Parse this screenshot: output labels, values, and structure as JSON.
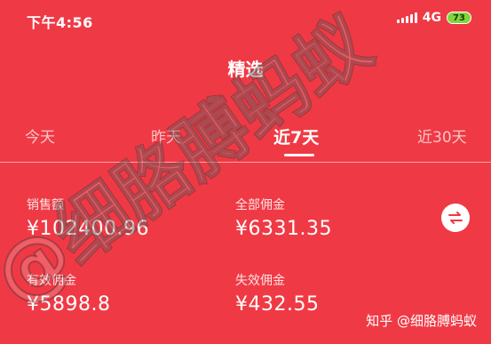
{
  "status_bar": {
    "time": "下午4:56",
    "network": "4G",
    "battery": "73",
    "colors": {
      "battery_fill": "#7ed63c"
    }
  },
  "header": {
    "title": "精选"
  },
  "tabs": [
    {
      "label": "今天",
      "active": false
    },
    {
      "label": "昨天",
      "active": false
    },
    {
      "label": "近7天",
      "active": true
    },
    {
      "label": "近30天",
      "active": false
    }
  ],
  "stats": {
    "sales": {
      "label": "销售额",
      "value": "¥102400.96"
    },
    "total_commission": {
      "label": "全部佣金",
      "value": "¥6331.35"
    },
    "valid_commission": {
      "label": "有效佣金",
      "value": "¥5898.8"
    },
    "invalid_commission": {
      "label": "失效佣金",
      "value": "¥432.55"
    }
  },
  "swap_icon": "swap-arrows-icon",
  "watermark": {
    "credit": "知乎 @细胳膊蚂蚁",
    "overlay_text": "@细胳膊蚂蚁"
  },
  "colors": {
    "background": "#ef3a45",
    "text": "#ffffff"
  }
}
